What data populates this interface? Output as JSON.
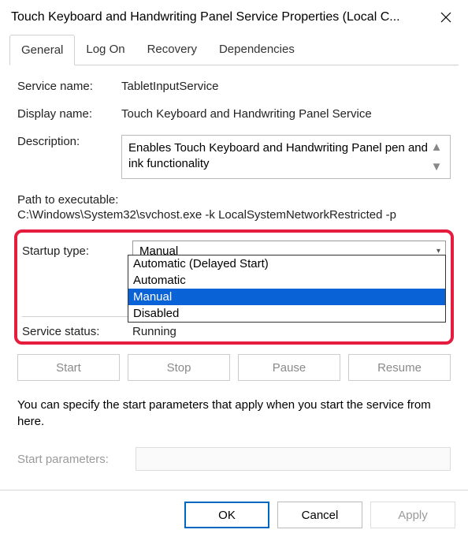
{
  "window": {
    "title": "Touch Keyboard and Handwriting Panel Service Properties (Local C..."
  },
  "tabs": {
    "general": "General",
    "logon": "Log On",
    "recovery": "Recovery",
    "dependencies": "Dependencies",
    "active": "general"
  },
  "fields": {
    "service_name_label": "Service name:",
    "service_name_value": "TabletInputService",
    "display_name_label": "Display name:",
    "display_name_value": "Touch Keyboard and Handwriting Panel Service",
    "description_label": "Description:",
    "description_value": "Enables Touch Keyboard and Handwriting Panel pen and ink functionality",
    "path_label": "Path to executable:",
    "path_value": "C:\\Windows\\System32\\svchost.exe -k LocalSystemNetworkRestricted -p",
    "startup_label": "Startup type:",
    "startup_value": "Manual",
    "startup_options": {
      "auto_delayed": "Automatic (Delayed Start)",
      "auto": "Automatic",
      "manual": "Manual",
      "disabled": "Disabled"
    },
    "status_label": "Service status:",
    "status_value": "Running"
  },
  "service_buttons": {
    "start": "Start",
    "stop": "Stop",
    "pause": "Pause",
    "resume": "Resume"
  },
  "hint": "You can specify the start parameters that apply when you start the service from here.",
  "start_params": {
    "label": "Start parameters:",
    "value": ""
  },
  "dialog_buttons": {
    "ok": "OK",
    "cancel": "Cancel",
    "apply": "Apply"
  }
}
